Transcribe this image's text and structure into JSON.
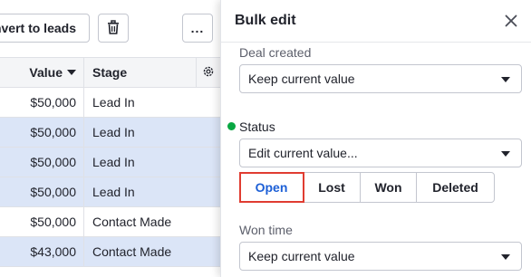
{
  "toolbar": {
    "convert_label": "Convert to leads",
    "trash_icon": "trash-icon",
    "more_label": "..."
  },
  "table": {
    "headers": {
      "value": "Value",
      "stage": "Stage"
    },
    "rows": [
      {
        "value": "$50,000",
        "stage": "Lead In",
        "selected": false
      },
      {
        "value": "$50,000",
        "stage": "Lead In",
        "selected": true
      },
      {
        "value": "$50,000",
        "stage": "Lead In",
        "selected": true
      },
      {
        "value": "$50,000",
        "stage": "Lead In",
        "selected": true
      },
      {
        "value": "$50,000",
        "stage": "Contact Made",
        "selected": false
      },
      {
        "value": "$43,000",
        "stage": "Contact Made",
        "selected": true
      }
    ]
  },
  "panel": {
    "title": "Bulk edit",
    "fields": {
      "deal_created": {
        "label": "Deal created",
        "value": "Keep current value"
      },
      "status": {
        "label": "Status",
        "value": "Edit current value...",
        "options": [
          "Open",
          "Lost",
          "Won",
          "Deleted"
        ],
        "selected": "Open"
      },
      "won_time": {
        "label": "Won time",
        "value": "Keep current value"
      }
    }
  },
  "colors": {
    "accent": "#1c5fd6",
    "selected_row": "#dbe5f7",
    "status_dot": "#08a742",
    "highlight_outline": "#e03c31"
  }
}
